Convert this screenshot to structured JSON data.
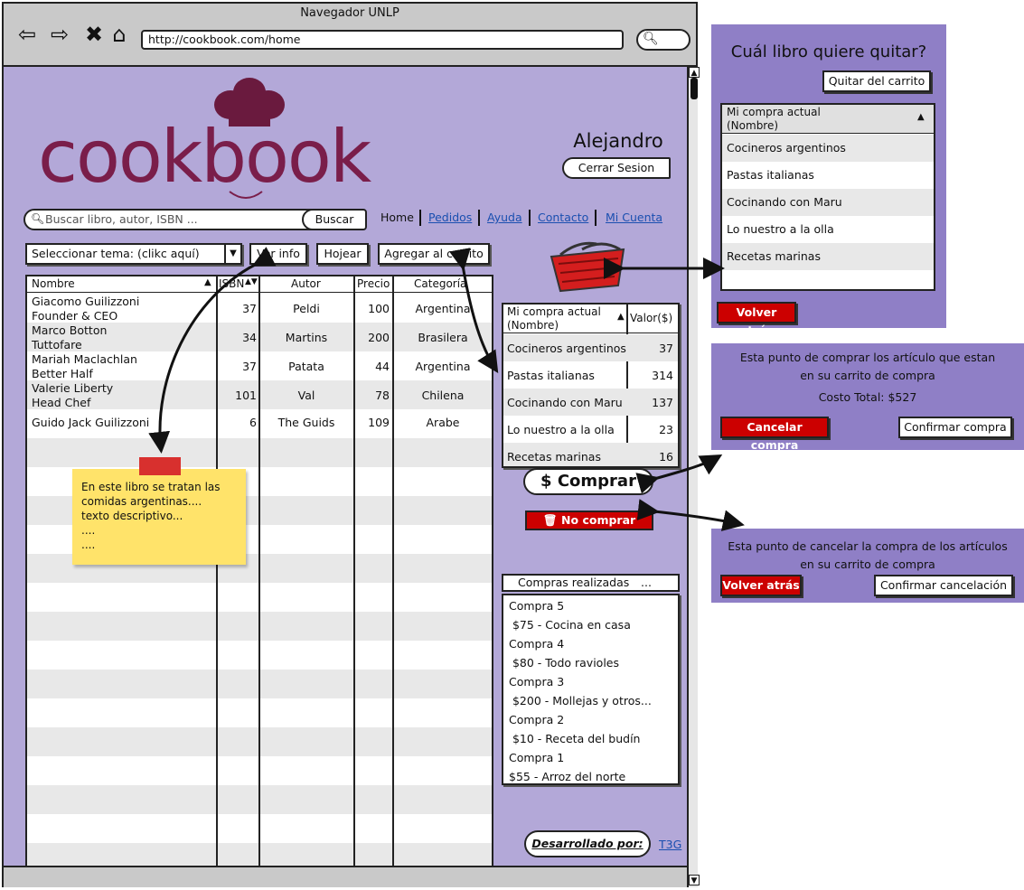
{
  "browser": {
    "title": "Navegador UNLP",
    "url": "http://cookbook.com/home",
    "icons": [
      "back-arrow-icon",
      "forward-arrow-icon",
      "close-x-icon",
      "home-icon",
      "search-icon"
    ]
  },
  "header": {
    "logo_text": "cookbook",
    "user_name": "Alejandro",
    "logout_label": "Cerrar Sesion"
  },
  "search": {
    "placeholder": "Buscar libro, autor, ISBN ...",
    "button_label": "Buscar"
  },
  "nav": {
    "home": "Home",
    "pedidos": "Pedidos",
    "ayuda": "Ayuda",
    "contacto": "Contacto",
    "cuenta": "Mi Cuenta"
  },
  "toolbar": {
    "topic_select": "Seleccionar tema: (clikc aquí)",
    "ver_info": "Ver info",
    "hojear": "Hojear",
    "agregar": "Agregar al carrito"
  },
  "books": {
    "columns": [
      "Nombre",
      "ISBN",
      "Autor",
      "Precio",
      "Categoría"
    ],
    "rows": [
      {
        "name1": "Giacomo Guilizzoni",
        "name2": "Founder & CEO",
        "isbn": "37",
        "author": "Peldi",
        "price": "100",
        "category": "Argentina"
      },
      {
        "name1": "Marco Botton",
        "name2": "Tuttofare",
        "isbn": "34",
        "author": "Martins",
        "price": "200",
        "category": "Brasilera"
      },
      {
        "name1": "Mariah Maclachlan",
        "name2": "Better Half",
        "isbn": "37",
        "author": "Patata",
        "price": "44",
        "category": "Argentina"
      },
      {
        "name1": "Valerie Liberty",
        "name2": "Head Chef",
        "isbn": "101",
        "author": "Val",
        "price": "78",
        "category": "Chilena"
      },
      {
        "name1": "Guido Jack Guilizzoni",
        "name2": "",
        "isbn": "6",
        "author": "The Guids",
        "price": "109",
        "category": "Arabe"
      }
    ]
  },
  "sticky_note": {
    "line1": "En este libro se tratan las",
    "line2": "comidas argentinas....",
    "line3": "texto descriptivo...",
    "line4": "....",
    "line5": "...."
  },
  "cart": {
    "col_name": "Mi compra actual (Nombre)",
    "col_value": "Valor($)",
    "rows": [
      {
        "name": "Cocineros argentinos",
        "value": "37"
      },
      {
        "name": "Pastas italianas",
        "value": "314"
      },
      {
        "name": "Cocinando con Maru",
        "value": "137"
      },
      {
        "name": "Lo nuestro a la olla",
        "value": "23"
      },
      {
        "name": "Recetas marinas",
        "value": "16"
      }
    ],
    "buy_label": "$ Comprar",
    "no_buy_label": "No comprar"
  },
  "purchases": {
    "header": "Compras realizadas",
    "header_more": "...",
    "items": [
      "Compra 5",
      " $75 - Cocina en casa",
      "Compra 4",
      " $80 - Todo ravioles",
      "Compra 3",
      " $200 - Mollejas y otros...",
      "Compra 2",
      " $10 - Receta del budín",
      "Compra 1",
      "$55 - Arroz del norte"
    ]
  },
  "footer": {
    "developed_by": "Desarrollado por:",
    "dev_link": "T3G"
  },
  "remove_panel": {
    "title": "Cuál libro quiere quitar?",
    "remove_button": "Quitar del carrito",
    "list_header": "Mi compra actual (Nombre)",
    "items": [
      "Cocineros argentinos",
      "Pastas italianas",
      "Cocinando con Maru",
      "Lo nuestro a la olla",
      "Recetas marinas"
    ],
    "back_button": "Volver atrás"
  },
  "confirm_panel": {
    "line1": "Esta punto de comprar los artículo que estan",
    "line2": "en su carrito de compra",
    "total": "Costo Total: $527",
    "cancel_button": "Cancelar compra",
    "confirm_button": "Confirmar compra"
  },
  "cancel_panel": {
    "line1": "Esta punto de cancelar la compra de los artículos",
    "line2": "en su carrito de compra",
    "back_button": "Volver atrás",
    "confirm_button": "Confirmar cancelación"
  },
  "colors": {
    "page_bg": "#b3a8d8",
    "panel_bg": "#8f7fc6",
    "logo": "#7a1e4a",
    "danger": "#cc0000",
    "link": "#1a4fb0"
  }
}
